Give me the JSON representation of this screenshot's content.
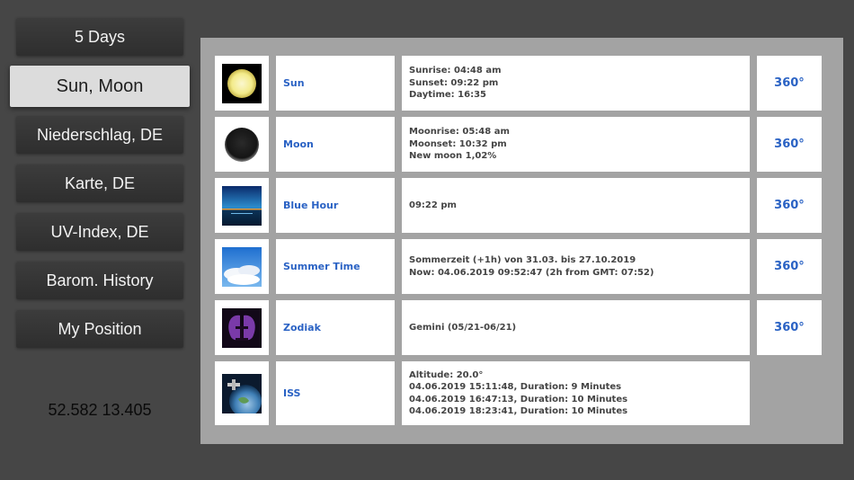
{
  "nav": {
    "items": [
      {
        "label": "5 Days"
      },
      {
        "label": "Sun, Moon"
      },
      {
        "label": "Niederschlag, DE"
      },
      {
        "label": "Karte, DE"
      },
      {
        "label": "UV-Index, DE"
      },
      {
        "label": "Barom. History"
      },
      {
        "label": "My Position"
      }
    ],
    "active_index": 1
  },
  "position": {
    "coords": "52.582 13.405"
  },
  "rows": [
    {
      "name": "Sun",
      "icon": "sun-icon",
      "lines": [
        "Sunrise: 04:48 am",
        "Sunset: 09:22 pm",
        "Daytime: 16:35"
      ],
      "degree": "360°"
    },
    {
      "name": "Moon",
      "icon": "moon-icon",
      "lines": [
        "Moonrise: 05:48 am",
        "Moonset: 10:32 pm",
        "New moon 1,02%"
      ],
      "degree": "360°"
    },
    {
      "name": "Blue Hour",
      "icon": "blue-hour-icon",
      "lines": [
        "09:22 pm"
      ],
      "degree": "360°"
    },
    {
      "name": "Summer Time",
      "icon": "summer-time-icon",
      "lines": [
        "Sommerzeit (+1h) von 31.03. bis 27.10.2019",
        "Now: 04.06.2019 09:52:47 (2h from GMT: 07:52)"
      ],
      "degree": "360°"
    },
    {
      "name": "Zodiak",
      "icon": "zodiac-gemini-icon",
      "lines": [
        "Gemini (05/21-06/21)"
      ],
      "degree": "360°"
    },
    {
      "name": "ISS",
      "icon": "iss-icon",
      "lines": [
        "Altitude: 20.0°",
        "04.06.2019 15:11:48, Duration: 9 Minutes",
        "04.06.2019 16:47:13, Duration: 10 Minutes",
        "04.06.2019 18:23:41, Duration: 10 Minutes"
      ]
    }
  ],
  "colors": {
    "background": "#464646",
    "panel": "#a3a3a3",
    "accent": "#2a62c4"
  }
}
